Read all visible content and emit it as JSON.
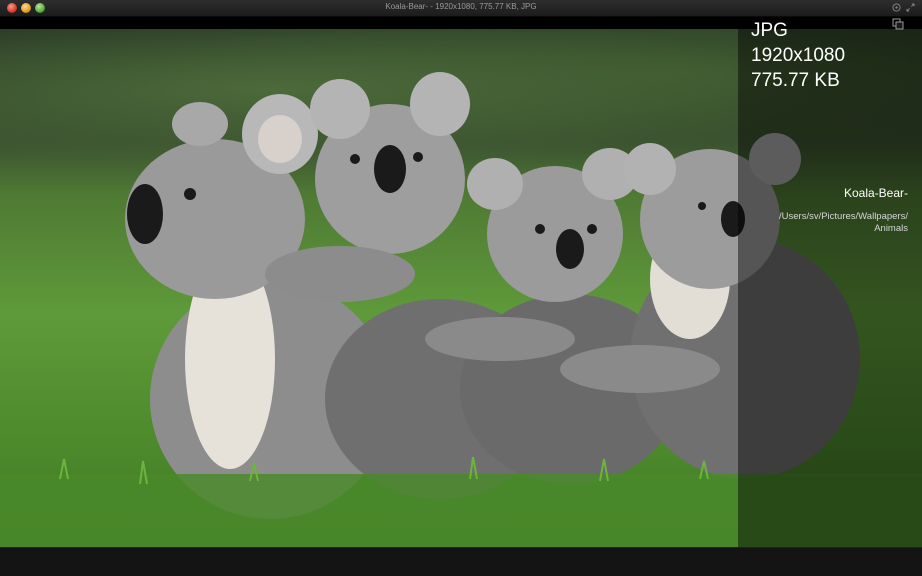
{
  "window": {
    "title": "Koala-Bear- - 1920x1080, 775.77 KB, JPG",
    "buttons": {
      "close": "close",
      "minimize": "minimize",
      "zoom": "zoom"
    }
  },
  "info": {
    "format": "JPG",
    "dimensions": "1920x1080",
    "file_size": "775.77 KB",
    "file_name": "Koala-Bear-",
    "file_path": "/Users/sv/Pictures/Wallpapers/ Animals"
  },
  "icons": {
    "copy": "copy-icon",
    "titlebar_left": "popout-icon",
    "titlebar_right": "fullscreen-icon"
  },
  "colors": {
    "titlebar": "#232323",
    "overlay": "#000000",
    "grass": "#5f9a3a",
    "koala_fur": "#8c8c8c"
  }
}
